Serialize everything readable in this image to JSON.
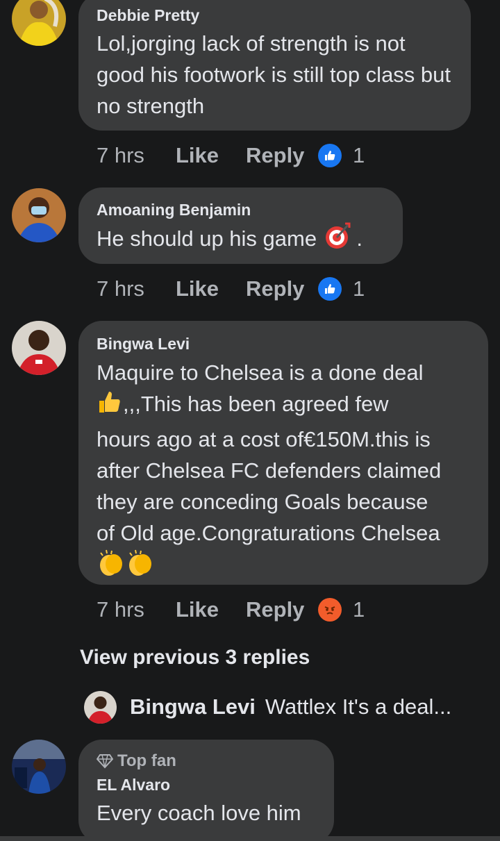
{
  "comments": [
    {
      "author": "Debbie Pretty",
      "text": "Lol,jorging lack of strength is not good his footwork is still top class but no strength",
      "time": "7 hrs",
      "like": "Like",
      "reply": "Reply",
      "reaction": "like-reaction-icon",
      "reaction_count": "1"
    },
    {
      "author": "Amoaning Benjamin",
      "text": "He should up his game",
      "text_suffix": " .",
      "emoji": "direct-hit-icon",
      "time": "7 hrs",
      "like": "Like",
      "reply": "Reply",
      "reaction": "like-reaction-icon",
      "reaction_count": "1"
    },
    {
      "author": "Bingwa Levi",
      "text_line1": "Maquire to Chelsea is a done deal",
      "text_line2": ",,,This has been agreed few",
      "text_line3": "hours ago at a cost of€150M.this is",
      "text_line4": "after Chelsea FC defenders claimed",
      "text_line5": "they are conceding Goals because",
      "text_line6": "of Old age.Congraturations Chelsea",
      "emoji_inline": "thumbs-up-icon",
      "emoji_trailing": "clapping-hands-icon",
      "time": "7 hrs",
      "like": "Like",
      "reply": "Reply",
      "reaction": "angry-reaction-icon",
      "reaction_count": "1"
    }
  ],
  "view_previous": "View previous 3 replies",
  "reply_preview": {
    "author": "Bingwa Levi",
    "text": "Wattlex It's a deal..."
  },
  "last_comment": {
    "badge": "Top fan",
    "author": "EL Alvaro",
    "text": "Every coach love him"
  },
  "colors": {
    "background": "#18191a",
    "bubble": "#3a3b3c",
    "like_blue": "#1877f2",
    "angry_orange": "#f25c2b"
  }
}
